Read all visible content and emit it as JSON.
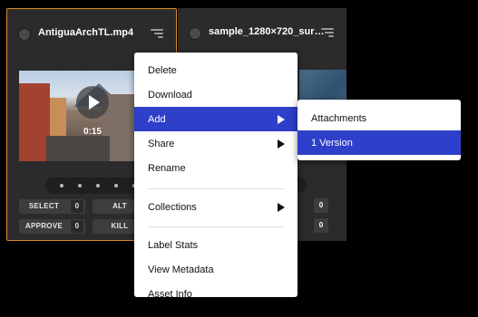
{
  "cards": [
    {
      "title": "AntiguaArchTL.mp4",
      "duration": "0:15",
      "tags": [
        {
          "label": "SELECT",
          "count": "0"
        },
        {
          "label": "ALT",
          "count": ""
        },
        {
          "label": "APPROVE",
          "count": "0"
        },
        {
          "label": "KILL",
          "count": ""
        }
      ]
    },
    {
      "title": "sample_1280×720_sur…",
      "counts": [
        "0",
        "0"
      ]
    }
  ],
  "context_menu": {
    "items": [
      {
        "label": "Delete"
      },
      {
        "label": "Download"
      },
      {
        "label": "Add",
        "submenu": true,
        "active": true
      },
      {
        "label": "Share",
        "submenu": true
      },
      {
        "label": "Rename"
      },
      {
        "label": "Collections",
        "submenu": true
      },
      {
        "label": "Label Stats"
      },
      {
        "label": "View Metadata"
      },
      {
        "label": "Asset Info"
      }
    ]
  },
  "submenu": {
    "items": [
      {
        "label": "Attachments"
      },
      {
        "label": "1 Version",
        "active": true
      }
    ]
  },
  "colors": {
    "accent": "#2e3fc9",
    "selected_border": "#d98a2a"
  }
}
